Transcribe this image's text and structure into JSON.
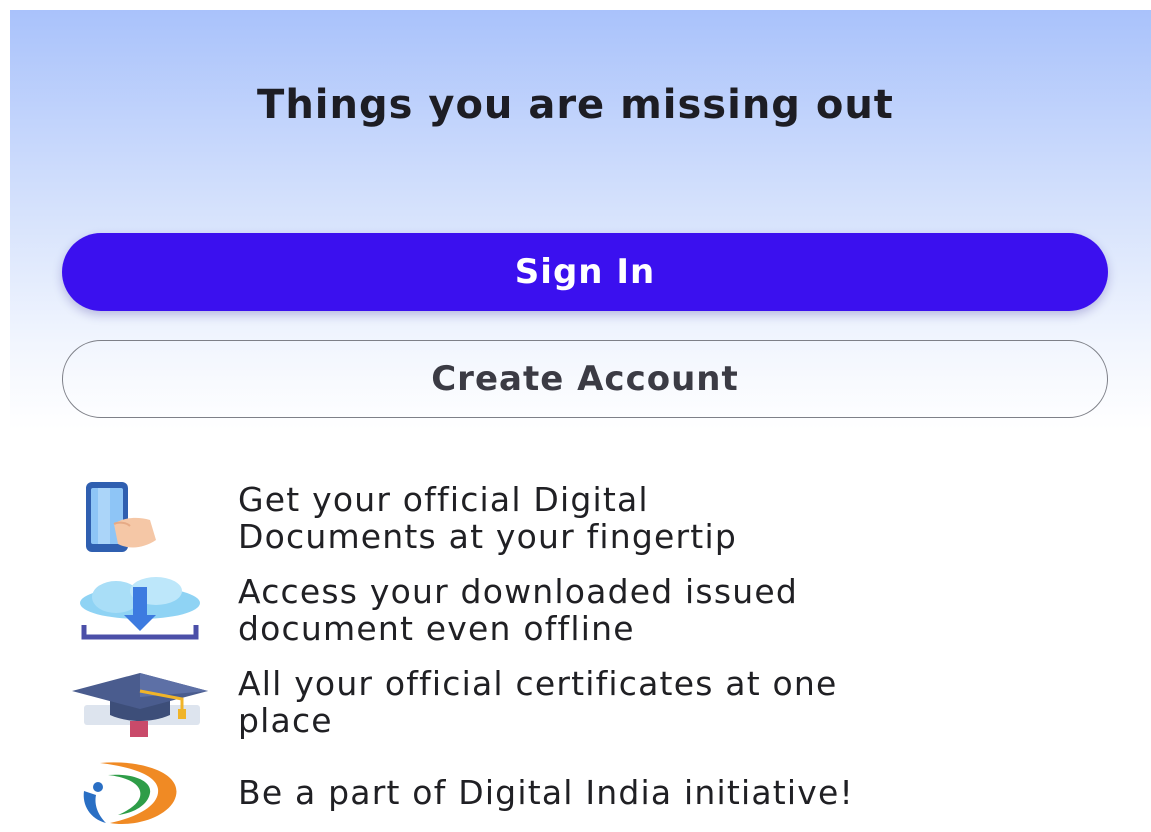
{
  "header": {
    "title": "Things you are missing out"
  },
  "actions": {
    "sign_in_label": "Sign In",
    "create_account_label": "Create Account"
  },
  "features": [
    {
      "icon": "phone-touch-icon",
      "text": "Get your official Digital\nDocuments at your fingertip"
    },
    {
      "icon": "cloud-download-icon",
      "text": "Access your downloaded issued\ndocument even offline"
    },
    {
      "icon": "graduation-cap-icon",
      "text": "All your official certificates at one\nplace"
    },
    {
      "icon": "digital-india-logo-icon",
      "text": "Be a part of Digital India initiative!"
    }
  ],
  "colors": {
    "primary": "#3b10ef",
    "hero_gradient_top": "#a9c2fb",
    "text": "#202024"
  }
}
